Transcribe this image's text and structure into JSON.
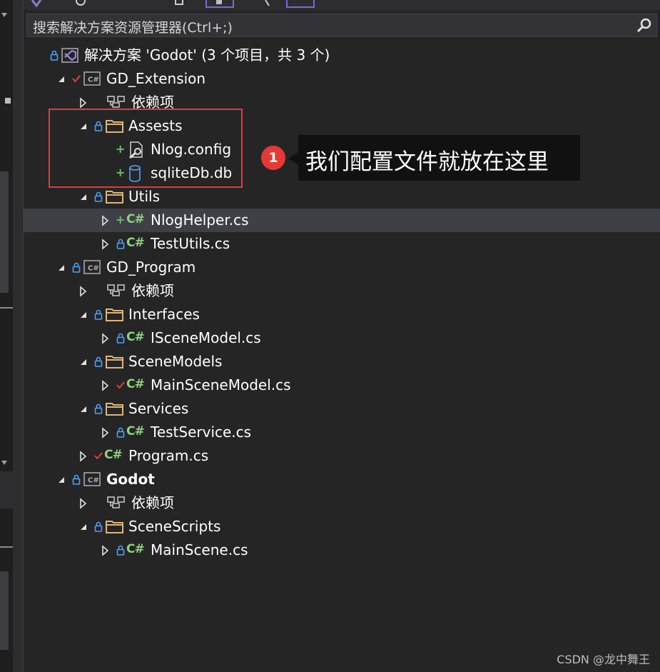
{
  "search": {
    "placeholder": "搜索解决方案资源管理器(Ctrl+;)"
  },
  "tree": [
    {
      "label": "解决方案 'Godot' (3 个项目，共 3 个)",
      "type": "solution",
      "lock": true
    },
    {
      "label": "GD_Extension",
      "type": "project",
      "check": true,
      "expanded": true
    },
    {
      "label": "依赖项",
      "type": "deps"
    },
    {
      "label": "Assests",
      "type": "folder",
      "lock": true,
      "expanded": true
    },
    {
      "label": "Nlog.config",
      "type": "config",
      "plus": true
    },
    {
      "label": "sqliteDb.db",
      "type": "db",
      "plus": true
    },
    {
      "label": "Utils",
      "type": "folder",
      "lock": true,
      "expanded": true
    },
    {
      "label": "NlogHelper.cs",
      "type": "cs",
      "plus": true,
      "selected": true
    },
    {
      "label": "TestUtils.cs",
      "type": "cs",
      "lock": true
    },
    {
      "label": "GD_Program",
      "type": "project",
      "lock": true,
      "expanded": true
    },
    {
      "label": "依赖项",
      "type": "deps"
    },
    {
      "label": "Interfaces",
      "type": "folder",
      "lock": true,
      "expanded": true
    },
    {
      "label": "ISceneModel.cs",
      "type": "cs",
      "lock": true
    },
    {
      "label": "SceneModels",
      "type": "folder",
      "lock": true,
      "expanded": true
    },
    {
      "label": "MainSceneModel.cs",
      "type": "cs",
      "check": true
    },
    {
      "label": "Services",
      "type": "folder",
      "lock": true,
      "expanded": true
    },
    {
      "label": "TestService.cs",
      "type": "cs",
      "lock": true
    },
    {
      "label": "Program.cs",
      "type": "cs",
      "check": true
    },
    {
      "label": "Godot",
      "type": "project",
      "lock": true,
      "expanded": true,
      "bold": true
    },
    {
      "label": "依赖项",
      "type": "deps"
    },
    {
      "label": "SceneScripts",
      "type": "folder",
      "lock": true,
      "expanded": true
    },
    {
      "label": "MainScene.cs",
      "type": "cs",
      "lock": true
    }
  ],
  "annotation": {
    "number": "1",
    "text": "我们配置文件就放在这里"
  },
  "watermark": "CSDN @龙中舞王",
  "colors": {
    "background": "#252526",
    "selected_row": "#3f3f46",
    "lock": "#4aa3ff",
    "check": "#e0413a",
    "csharp": "#8ed27a",
    "folder": "#dcb67a",
    "annotation_red": "#e53935"
  }
}
